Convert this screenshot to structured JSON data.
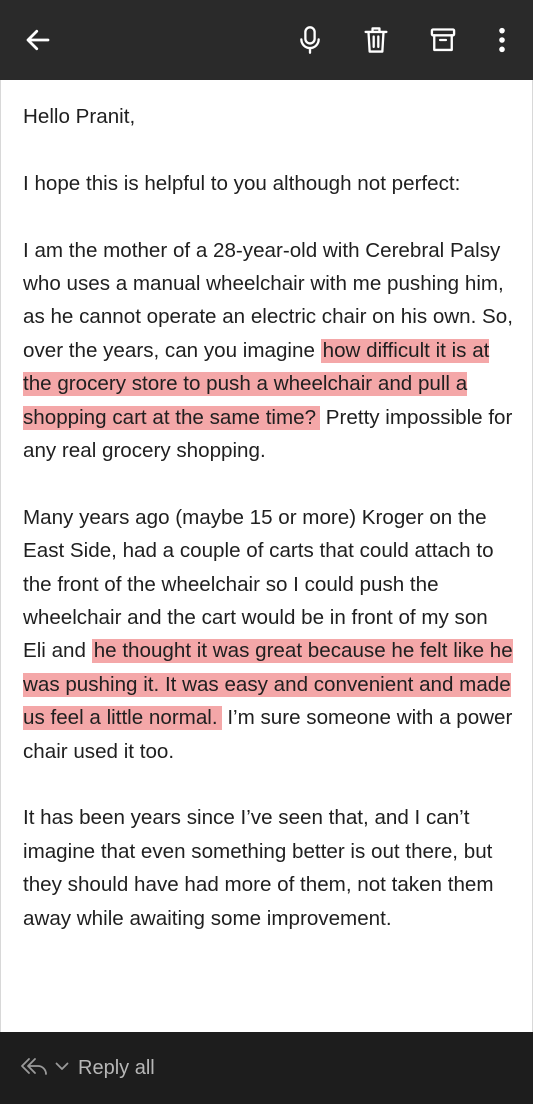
{
  "toolbar": {
    "icons": [
      "back-arrow-icon",
      "microphone-icon",
      "trash-icon",
      "archive-icon",
      "more-vertical-icon"
    ]
  },
  "email": {
    "greeting": "Hello Pranit,",
    "p1": "I hope this is helpful to you although not perfect:",
    "p2": {
      "a": "I am the mother of a 28-year-old with Cerebral Palsy who uses a manual wheelchair with me pushing him, as he cannot operate an electric chair on his own. So, over the years, can you imagine",
      "highlight": "how difficult it is at the grocery store to push a wheelchair and pull a shopping cart at the same time?",
      "b": "Pretty impossible for any real grocery shopping."
    },
    "p3": {
      "a": "Many years ago (maybe 15 or more) Kroger on the East Side, had a couple of carts that could attach to the front of the wheelchair so I could push the wheelchair and the cart would be in front of my son Eli and",
      "highlight": "he thought it was great because he felt like he was pushing it.  It was easy and convenient and made us feel a little normal.",
      "b": "I’m sure someone with a power chair used it too."
    },
    "p4": "It has been years since I’ve seen that, and I can’t imagine that even something better is out there, but they should have had more of them, not taken them away while awaiting some improvement."
  },
  "bottom": {
    "reply_all_label": "Reply all"
  },
  "colors": {
    "topbar": "#2a2a2a",
    "highlight": "#f4a7a8",
    "bottombar": "#1d1d1d"
  }
}
